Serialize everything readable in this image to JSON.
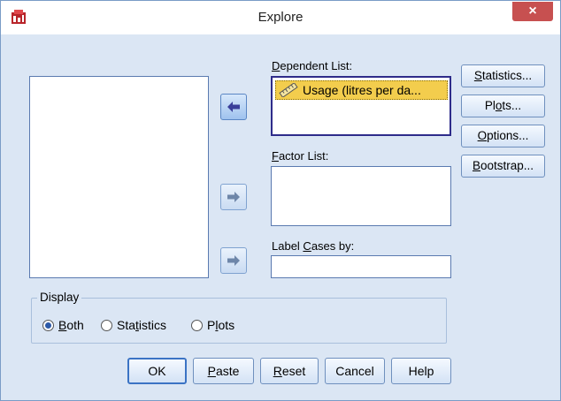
{
  "window": {
    "title": "Explore",
    "close_label": "×"
  },
  "icons": {
    "app": "spss-explore-icon",
    "ruler": "scale-variable-icon",
    "arrow_left": "move-left-arrow-icon",
    "arrow_right": "move-right-arrow-icon"
  },
  "dependent_list": {
    "label_pre": "",
    "label_u": "D",
    "label_post": "ependent List:",
    "items": [
      {
        "label": "Usage (litres per da..."
      }
    ]
  },
  "factor_list": {
    "label_pre": "",
    "label_u": "F",
    "label_post": "actor List:"
  },
  "label_cases": {
    "label_pre": "Label ",
    "label_u": "C",
    "label_post": "ases by:"
  },
  "side_buttons": {
    "statistics": {
      "pre": "",
      "u": "S",
      "post": "tatistics..."
    },
    "plots": {
      "pre": "Pl",
      "u": "o",
      "post": "ts..."
    },
    "options": {
      "pre": "",
      "u": "O",
      "post": "ptions..."
    },
    "bootstrap": {
      "pre": "",
      "u": "B",
      "post": "ootstrap..."
    }
  },
  "display": {
    "legend": "Display",
    "options": {
      "both": {
        "pre": "",
        "u": "B",
        "post": "oth",
        "selected": true
      },
      "statistics": {
        "pre": "Sta",
        "u": "t",
        "post": "istics",
        "selected": false
      },
      "plots": {
        "pre": "P",
        "u": "l",
        "post": "ots",
        "selected": false
      }
    }
  },
  "buttons": {
    "ok": "OK",
    "paste": {
      "pre": "",
      "u": "P",
      "post": "aste"
    },
    "reset": {
      "pre": "",
      "u": "R",
      "post": "eset"
    },
    "cancel": "Cancel",
    "help": "Help"
  },
  "colors": {
    "dialog_bg": "#dbe6f4",
    "selected_item": "#f3cd4d",
    "close_button": "#c75050",
    "focus_border": "#2e2c8a"
  }
}
